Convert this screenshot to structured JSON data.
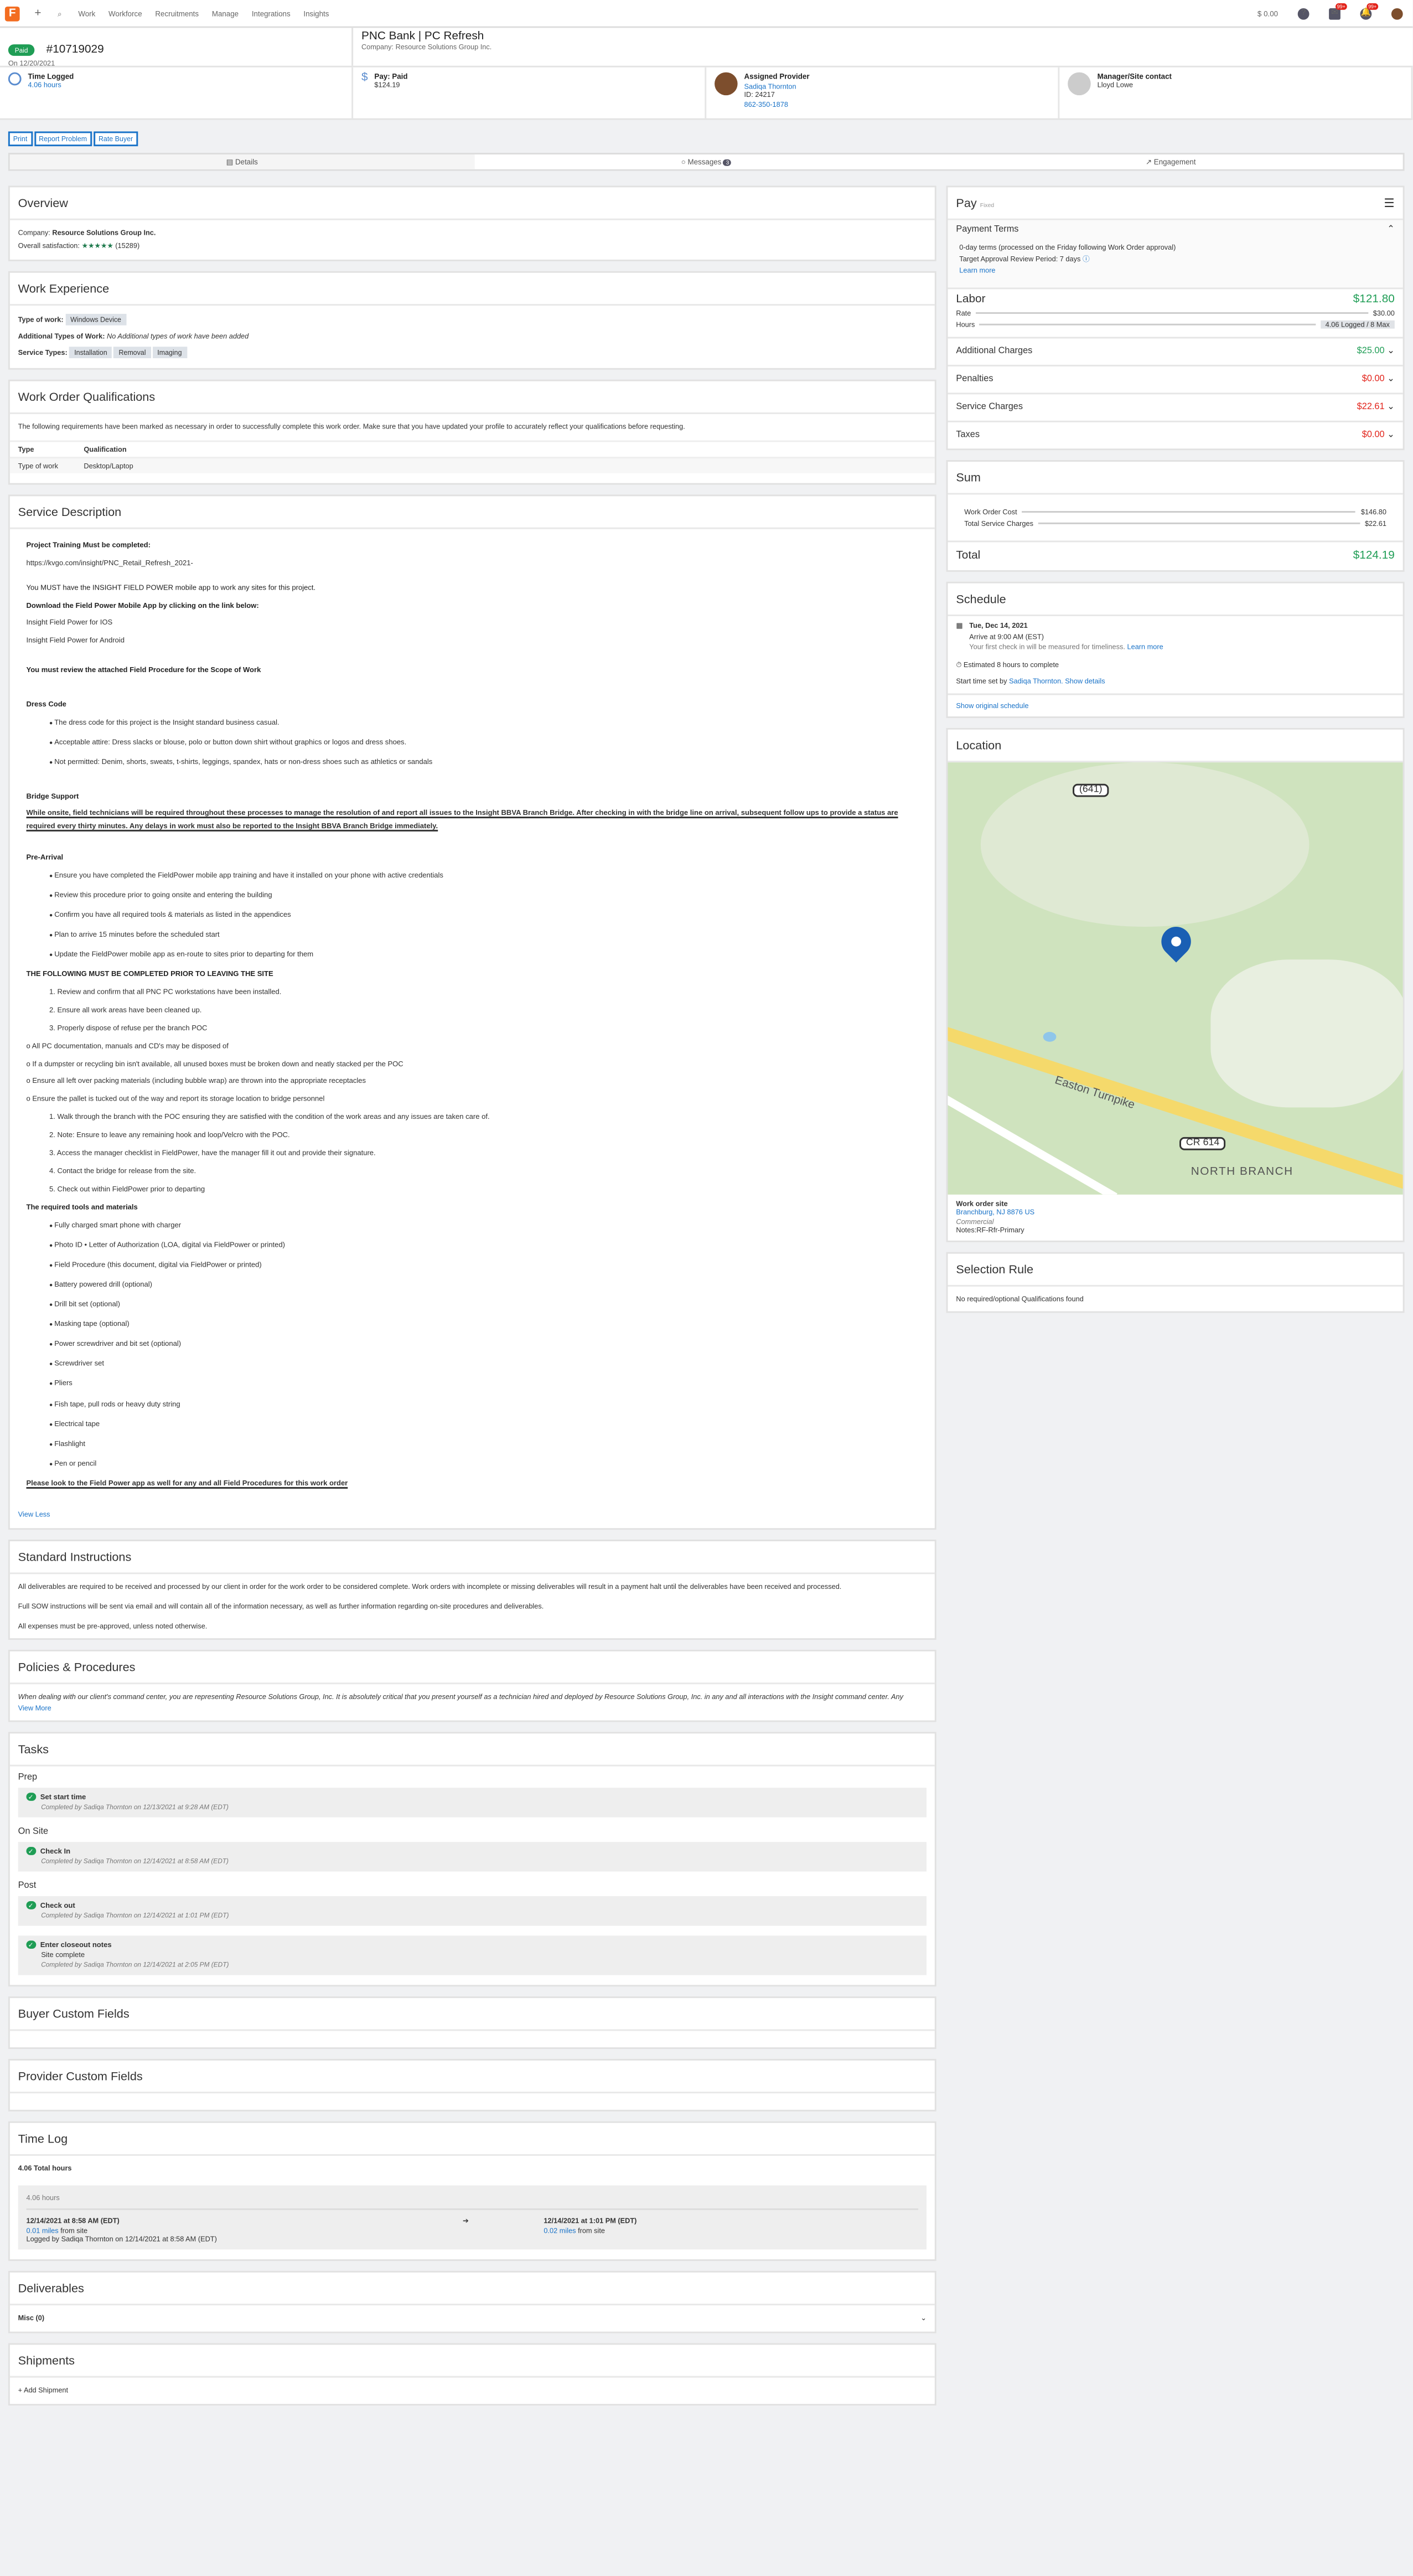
{
  "nav": {
    "items": [
      "Work",
      "Workforce",
      "Recruitments",
      "Manage",
      "Integrations",
      "Insights"
    ],
    "balance": "0.00",
    "notif_count": "99+",
    "msg_count": "99+"
  },
  "header": {
    "status": "Paid",
    "wo_number": "#10719029",
    "date": "On 12/20/2021",
    "title": "PNC Bank | PC Refresh",
    "company": "Company: Resource Solutions Group Inc."
  },
  "strip": {
    "time_label": "Time Logged",
    "time_value": "4.06 hours",
    "pay_label": "Pay: Paid",
    "pay_value": "$124.19",
    "provider_label": "Assigned Provider",
    "provider_name": "Sadiqa Thornton",
    "provider_id": "ID: 24217",
    "provider_phone": "862-350-1878",
    "mgr_label": "Manager/Site contact",
    "mgr_name": "Lloyd Lowe"
  },
  "buttons": [
    "Print",
    "Report Problem",
    "Rate Buyer"
  ],
  "tabs": {
    "details": "Details",
    "messages": "Messages",
    "messages_count": "3",
    "engagement": "Engagement"
  },
  "overview": {
    "title": "Overview",
    "company_label": "Company:",
    "company": "Resource Solutions Group Inc.",
    "satisfaction_label": "Overall satisfaction:",
    "stars": "★★★★★",
    "reviews": "(15289)"
  },
  "experience": {
    "title": "Work Experience",
    "type_label": "Type of work:",
    "type": "Windows Device",
    "additional_label": "Additional Types of Work:",
    "additional": "No Additional types of work have been added",
    "service_label": "Service Types:",
    "services": [
      "Installation",
      "Removal",
      "Imaging"
    ]
  },
  "qualifications": {
    "title": "Work Order Qualifications",
    "intro": "The following requirements have been marked as necessary in order to successfully complete this work order. Make sure that you have updated your profile to accurately reflect your qualifications before requesting.",
    "col_type": "Type",
    "col_qual": "Qualification",
    "row_type": "Type of work",
    "row_qual": "Desktop/Laptop"
  },
  "service": {
    "title": "Service Description",
    "training": "Project Training Must be completed:",
    "url": "https://kvgo.com/insight/PNC_Retail_Refresh_2021-",
    "must1": "You MUST have the INSIGHT FIELD POWER mobile app to work any sites for this project.",
    "download": "Download the Field Power Mobile App by clicking on the link below:",
    "ios": "Insight Field Power for IOS",
    "android": "Insight Field Power for Android",
    "review": "You must review the attached Field Procedure for the Scope of Work",
    "dress_title": "Dress Code",
    "dress": [
      "The dress code for this project is the Insight standard business casual.",
      "Acceptable attire: Dress slacks or blouse, polo or button down shirt without graphics or logos and dress shoes.",
      "Not permitted: Denim, shorts, sweats, t-shirts, leggings, spandex, hats or non-dress shoes such as athletics or sandals"
    ],
    "bridge_title": "Bridge Support",
    "bridge": "While onsite, field technicians will be required throughout these processes to manage the resolution of and report all issues to the Insight BBVA Branch Bridge. After checking in with the bridge line on arrival, subsequent follow ups to provide a status are required every thirty minutes. Any delays in work must also be reported to the Insight BBVA Branch Bridge immediately.",
    "pre_title": "Pre-Arrival",
    "pre": [
      "Ensure you have completed the FieldPower mobile app training and have it installed on your phone with active credentials",
      "Review this procedure prior to going onsite and entering the building",
      "Confirm you have all required tools & materials as listed in the appendices",
      "Plan to arrive 15 minutes before the scheduled start",
      "Update the FieldPower mobile app as en-route to sites prior to departing for them"
    ],
    "leave_title": "THE FOLLOWING MUST BE COMPLETED PRIOR TO LEAVING THE SITE",
    "leave1": [
      "1. Review and confirm that all PNC PC workstations have been installed.",
      "2. Ensure all work areas have been cleaned up.",
      "3. Properly dispose of refuse per the branch POC"
    ],
    "leave_o": [
      "o All PC documentation, manuals and CD's may be disposed of",
      "o If a dumpster or recycling bin isn't available, all unused boxes must be broken down and neatly stacked per the POC",
      "o Ensure all left over packing materials (including bubble wrap) are thrown into the appropriate receptacles",
      "o Ensure the pallet is tucked out of the way and report its storage location to bridge personnel"
    ],
    "leave2": [
      "1. Walk through the branch with the POC ensuring they are satisfied with the condition of the work areas and any issues are taken care of.",
      "2. Note: Ensure to leave any remaining hook and loop/Velcro with the POC.",
      "3. Access the manager checklist in FieldPower, have the manager fill it out and provide their signature.",
      "4. Contact the bridge for release from the site.",
      "5. Check out within FieldPower prior to departing"
    ],
    "tools_title": "The required tools and materials",
    "tools": [
      "Fully charged smart phone with charger",
      "Photo ID • Letter of Authorization (LOA, digital via FieldPower or printed)",
      "Field Procedure (this document, digital via FieldPower or printed)",
      "Battery powered drill (optional)",
      "Drill bit set (optional)",
      "Masking tape (optional)",
      "Power screwdriver and bit set (optional)",
      "Screwdriver set",
      "Pliers",
      "Fish tape, pull rods or heavy duty string",
      "Electrical tape",
      "Flashlight",
      "Pen or pencil"
    ],
    "final": "Please look to the Field Power app as well for any and all Field Procedures for this work order",
    "view_less": "View Less"
  },
  "standard": {
    "title": "Standard Instructions",
    "p1": "All deliverables are required to be received and processed by our client in order for the work order to be considered complete. Work orders with incomplete or missing deliverables will result in a payment halt until the deliverables have been received and processed.",
    "p2": "Full SOW instructions will be sent via email and will contain all of the information necessary, as well as further information regarding on-site procedures and deliverables.",
    "p3": "All expenses must be pre-approved, unless noted otherwise."
  },
  "policies": {
    "title": "Policies & Procedures",
    "text": "When dealing with our client's command center, you are representing Resource Solutions Group, Inc. It is absolutely critical that you present yourself as a technician hired and deployed by Resource Solutions Group, Inc. in any and all interactions with the Insight command center. Any",
    "more": "View More"
  },
  "tasks": {
    "title": "Tasks",
    "prep": "Prep",
    "onsite": "On Site",
    "post": "Post",
    "t1": "Set start time",
    "t1c": "Completed by Sadiqa Thornton on 12/13/2021 at 9:28 AM (EDT)",
    "t2": "Check In",
    "t2c": "Completed by Sadiqa Thornton on 12/14/2021 at 8:58 AM (EDT)",
    "t3": "Check out",
    "t3c": "Completed by Sadiqa Thornton on 12/14/2021 at 1:01 PM (EDT)",
    "t4": "Enter closeout notes",
    "t4n": "Site complete",
    "t4c": "Completed by Sadiqa Thornton on 12/14/2021 at 2:05 PM (EDT)"
  },
  "buyer_fields": "Buyer Custom Fields",
  "provider_fields": "Provider Custom Fields",
  "timelog": {
    "title": "Time Log",
    "total": "4.06 Total hours",
    "hours": "4.06 hours",
    "in": "12/14/2021 at 8:58 AM (EDT)",
    "in_dist": "0.01 miles",
    "in_from": "from site",
    "logged": "Logged by Sadiqa Thornton on 12/14/2021 at 8:58 AM (EDT)",
    "out": "12/14/2021 at 1:01 PM (EDT)",
    "out_dist": "0.02 miles",
    "out_from": "from site"
  },
  "deliverables": {
    "title": "Deliverables",
    "misc": "Misc (0)"
  },
  "shipments": {
    "title": "Shipments",
    "add": "Add Shipment"
  },
  "pay": {
    "title": "Pay",
    "sub": "Fixed",
    "terms_title": "Payment Terms",
    "terms": "0-day terms (processed on the Friday following Work Order approval)",
    "approval": "Target Approval Review Period: 7 days",
    "learn": "Learn more",
    "labor": "Labor",
    "labor_amt": "$121.80",
    "rate": "Rate",
    "rate_amt": "$30.00",
    "hours": "Hours",
    "hours_val": "4.06 Logged / 8 Max",
    "additional": "Additional Charges",
    "additional_amt": "$25.00",
    "penalties": "Penalties",
    "penalties_amt": "$0.00",
    "service": "Service Charges",
    "service_amt": "$22.61",
    "taxes": "Taxes",
    "taxes_amt": "$0.00"
  },
  "sum": {
    "title": "Sum",
    "wo_cost": "Work Order Cost",
    "wo_cost_amt": "$146.80",
    "svc": "Total Service Charges",
    "svc_amt": "$22.61",
    "total": "Total",
    "total_amt": "$124.19"
  },
  "schedule": {
    "title": "Schedule",
    "date": "Tue, Dec 14, 2021",
    "arrive": "Arrive at 9:00 AM (EST)",
    "timeliness": "Your first check in will be measured for timeliness.",
    "learn": "Learn more",
    "estimate": "Estimated 8 hours to complete",
    "set_by": "Start time set by",
    "set_name": "Sadiqa Thornton.",
    "show": "Show details",
    "original": "Show original schedule"
  },
  "location": {
    "title": "Location",
    "road1": "(641)",
    "road2": "Easton Turnpike",
    "road3": "CR 614",
    "town": "NORTH BRANCH",
    "site": "Work order site",
    "city": "Branchburg, NJ 8876 US",
    "type": "Commercial",
    "notes": "Notes:RF-Rfr-Primary"
  },
  "selection": {
    "title": "Selection Rule",
    "text": "No required/optional Qualifications found"
  }
}
